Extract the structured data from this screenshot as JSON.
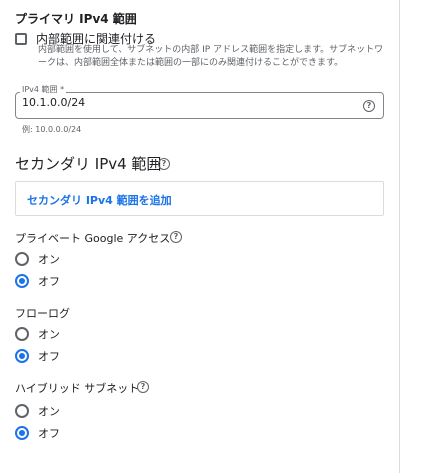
{
  "primary_ipv4": {
    "title": "プライマリ IPv4 範囲",
    "checkbox_label": "内部範囲に関連付ける",
    "checkbox_checked": false,
    "checkbox_help": "内部範囲を使用して、サブネットの内部 IP アドレス範囲を指定します。サブネットワークは、内部範囲全体または範囲の一部にのみ関連付けることができます。",
    "field_label": "IPv4 範囲 *",
    "field_value": "10.1.0.0/24",
    "help_icon_glyph": "?",
    "example_text": "例: 10.0.0.0/24"
  },
  "secondary_ipv4": {
    "title": "セカンダリ IPv4 範囲",
    "help_icon_glyph": "?",
    "add_link": "セカンダリ IPv4 範囲を追加"
  },
  "private_google_access": {
    "label": "プライベート Google アクセス",
    "help_icon_glyph": "?",
    "options": [
      "オン",
      "オフ"
    ],
    "selected": "オフ"
  },
  "flow_logs": {
    "label": "フローログ",
    "options": [
      "オン",
      "オフ"
    ],
    "selected": "オフ"
  },
  "hybrid_subnet": {
    "label": "ハイブリッド サブネット",
    "help_icon_glyph": "?",
    "options": [
      "オン",
      "オフ"
    ],
    "selected": "オフ"
  },
  "colors": {
    "accent": "#1a73e8",
    "text": "#202124",
    "muted": "#5f6368",
    "border": "#dadce0"
  }
}
